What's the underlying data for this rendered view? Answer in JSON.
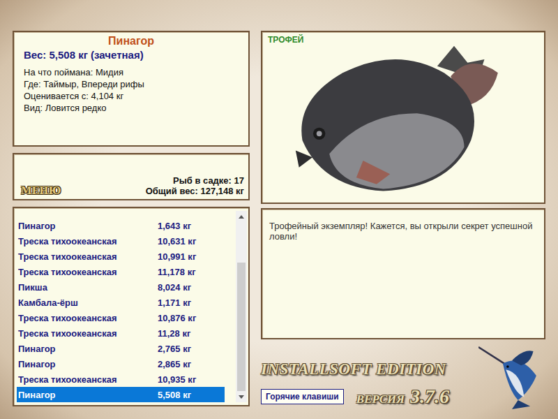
{
  "fish_card": {
    "name": "Пинагор",
    "weight": "Вес: 5,508 кг (зачетная)",
    "details": [
      "На что поймана: Мидия",
      "Где: Таймыр, Впереди рифы",
      "Оценивается с: 4,104 кг",
      "Вид: Ловится редко"
    ]
  },
  "menu_button": "МЕНЮ",
  "keepnet": {
    "count": "Рыб в садке: 17",
    "total": "Общий вес: 127,148 кг"
  },
  "catch_list": {
    "rows": [
      {
        "name": "Пинагор",
        "weight": "1,643 кг",
        "selected": false
      },
      {
        "name": "Треска тихоокеанская",
        "weight": "10,631 кг",
        "selected": false
      },
      {
        "name": "Треска тихоокеанская",
        "weight": "10,991 кг",
        "selected": false
      },
      {
        "name": "Треска тихоокеанская",
        "weight": "11,178 кг",
        "selected": false
      },
      {
        "name": "Пикша",
        "weight": "8,024 кг",
        "selected": false
      },
      {
        "name": "Камбала-ёрш",
        "weight": "1,171 кг",
        "selected": false
      },
      {
        "name": "Треска тихоокеанская",
        "weight": "10,876 кг",
        "selected": false
      },
      {
        "name": "Треска тихоокеанская",
        "weight": "11,28 кг",
        "selected": false
      },
      {
        "name": "Пинагор",
        "weight": "2,765 кг",
        "selected": false
      },
      {
        "name": "Пинагор",
        "weight": "2,865 кг",
        "selected": false
      },
      {
        "name": "Треска тихоокеанская",
        "weight": "10,935 кг",
        "selected": false
      },
      {
        "name": "Пинагор",
        "weight": "5,508 кг",
        "selected": true
      }
    ],
    "scrollbar": {
      "level": 0.76
    }
  },
  "trophy": {
    "badge": "ТРОФЕЙ",
    "message": "Трофейный экземпляр! Кажется, вы открыли секрет успешной ловли!"
  },
  "brand": {
    "edition": "INSTALLSOFT EDITION",
    "version_label": "ВЕРСИЯ",
    "version": "3.7.6"
  },
  "hotkeys_button": "Горячие клавиши"
}
